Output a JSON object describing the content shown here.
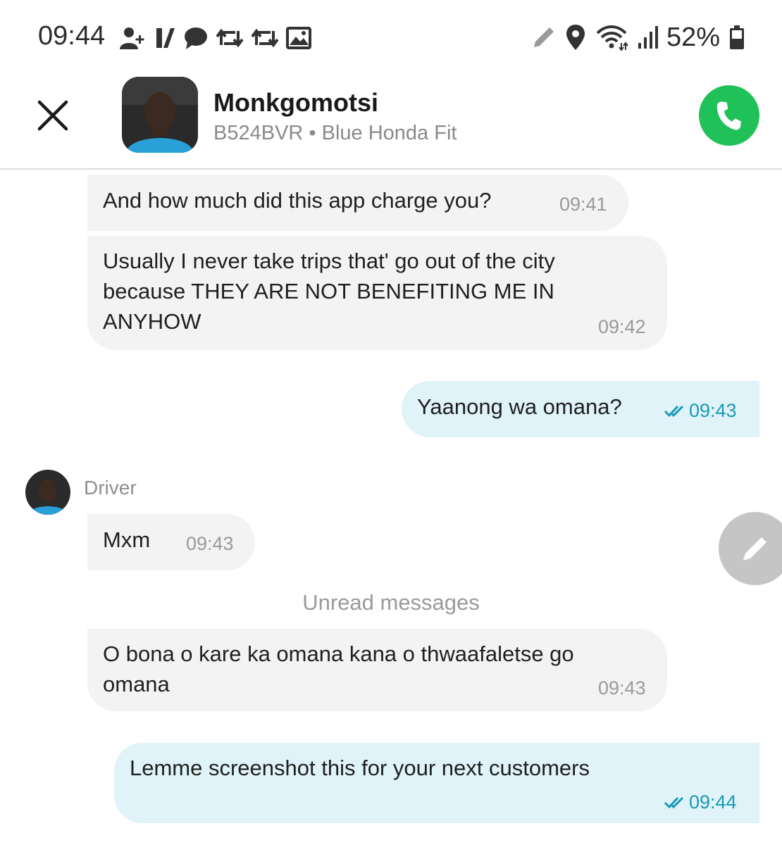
{
  "status_bar": {
    "time": "09:44",
    "battery": "52%",
    "icons_left": [
      "add-contact-icon",
      "app-y-icon",
      "chat-icon",
      "retweet-icon",
      "retweet-icon",
      "image-icon"
    ],
    "icons_right": [
      "pen-icon",
      "location-icon",
      "wifi-icon",
      "signal-icon",
      "battery-icon"
    ]
  },
  "header": {
    "close_icon": "close-icon",
    "name": "Monkgomotsi",
    "vehicle": "B524BVR • Blue Honda Fit",
    "call_icon": "phone-icon"
  },
  "messages": [
    {
      "side": "in",
      "text": "And how much did this app charge you?",
      "time": "09:41"
    },
    {
      "side": "in",
      "text": "Usually I never take trips that' go out of the city because THEY ARE NOT BENEFITING ME IN ANYHOW",
      "time": "09:42"
    },
    {
      "side": "out",
      "text": "Yaanong wa omana?",
      "time": "09:43"
    },
    {
      "side": "in",
      "text": "Mxm",
      "time": "09:43"
    },
    {
      "side": "in",
      "text": "O bona o kare ka omana kana o thwaafaletse go omana",
      "time": "09:43"
    },
    {
      "side": "out",
      "text": "Lemme screenshot this for your next customers",
      "time": "09:44"
    }
  ],
  "driver_label": "Driver",
  "unread_label": "Unread messages",
  "colors": {
    "call_green": "#21c15a",
    "incoming_bubble": "#f3f3f4",
    "outgoing_bubble": "#dff3f8",
    "read_tick": "#1a9ab8"
  }
}
